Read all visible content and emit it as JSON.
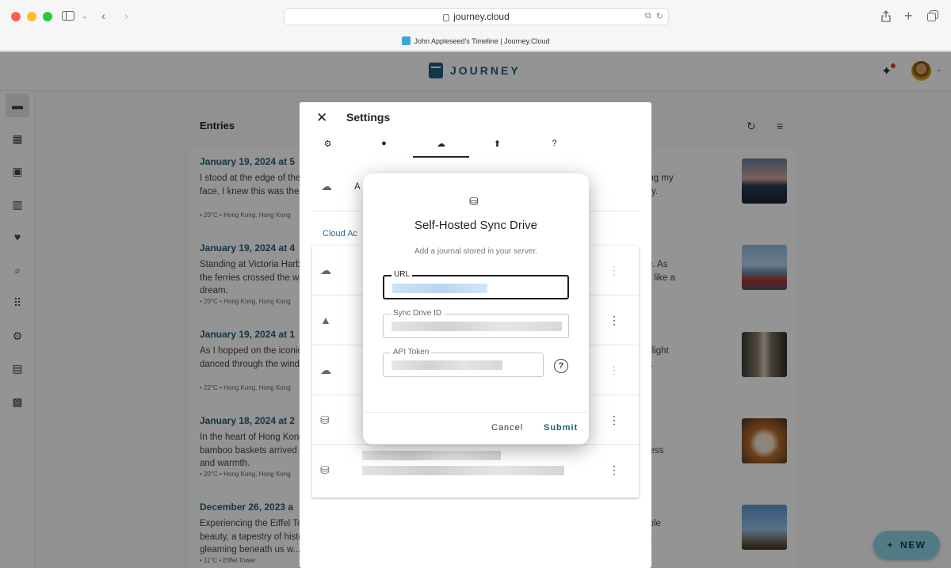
{
  "browser": {
    "url": "journey.cloud",
    "tab_title": "John Appleseed's Timeline | Journey.Cloud"
  },
  "app": {
    "logo": "JOURNEY",
    "entries_title": "Entries",
    "new_button": "NEW",
    "sidebar": [
      "journal-icon",
      "calendar-icon",
      "photos-icon",
      "map-icon",
      "heart-icon",
      "search-icon",
      "apps-icon",
      "gear-icon",
      "briefcase-icon",
      "gift-icon"
    ],
    "entries": [
      {
        "date": "January 19, 2024 at 5",
        "text": "I stood at the edge of the harbor, taking in the skyline as the sun dipped toward the water. With the wind caressing my face, I knew this was the start of a breathtaking journey. I could not wait to explore every corner of this vibrant city.",
        "meta": "• 20°C • Hong Kong, Hong Kong"
      },
      {
        "date": "January 19, 2024 at 4",
        "text": "Standing at Victoria Harbour, I was captivated by the sprawling cityscape and natural beauty that surrounded me. As the ferries crossed the water, I felt tears of wonder welling up in my eyes. The iconic skyline stretched before me like a dream.",
        "meta": "• 20°C • Hong Kong, Hong Kong"
      },
      {
        "date": "January 19, 2024 at 1",
        "text": "As I hopped on the iconic tram, the city unfolded around me in a symphony of sights and sounds. The afternoon light danced through the windows as we rolled slowly through the bustling streets. Sitting back, I watched life pass by.",
        "meta": "• 22°C • Hong Kong, Hong Kong"
      },
      {
        "date": "January 18, 2024 at 2",
        "text": "In the heart of Hong Kong, I discovered a tiny dim sum restaurant tucked away from the crowds. The steaming bamboo baskets arrived one after another, each filled with delicate treats. Every morsel burst with savory goodness and warmth.",
        "meta": "• 20°C • Hong Kong, Hong Kong"
      },
      {
        "date": "December 26, 2023 a",
        "text": "Experiencing the Eiffel Tower today was surreal. As we ascended, Paris sprawled below us, revealing its incredible beauty, a tapestry of history and culture. Reaching the top, the chilling breeze bore the city's tales. The city lights gleaming beneath us w...",
        "meta": "• 11°C • Eiffel Tower"
      }
    ]
  },
  "settings": {
    "title": "Settings",
    "tabs": [
      "gear-icon",
      "account-icon",
      "cloud-sync-icon",
      "upload-icon",
      "help-icon"
    ],
    "active_tab": 2,
    "add_row_label": "A",
    "section_label": "Cloud Ac",
    "accounts": [
      "cloud-icon",
      "google-drive-icon",
      "cloud-icon",
      "drive-icon",
      "drive-icon"
    ]
  },
  "modal": {
    "title": "Self-Hosted Sync Drive",
    "subtitle": "Add a journal stored in your server.",
    "url_label": "URL",
    "drive_id_label": "Sync Drive ID",
    "token_label": "API Token",
    "cancel": "Cancel",
    "submit": "Submit"
  },
  "colors": {
    "accent": "#1f5d7a",
    "new_button_bg": "#8dd3e6"
  }
}
